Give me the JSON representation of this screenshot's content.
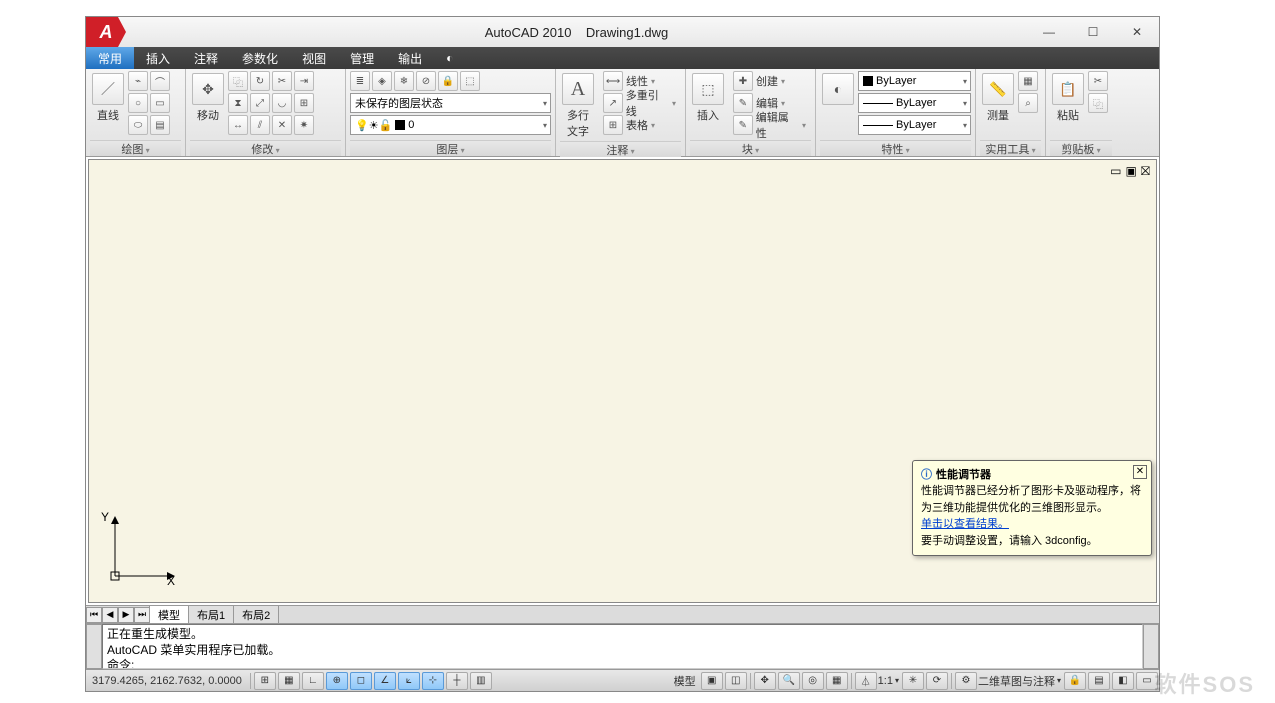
{
  "title": {
    "app": "AutoCAD 2010",
    "doc": "Drawing1.dwg"
  },
  "menu": [
    "常用",
    "插入",
    "注释",
    "参数化",
    "视图",
    "管理",
    "输出",
    "◐"
  ],
  "menu_active": 0,
  "panels": {
    "draw": {
      "title": "绘图",
      "line_label": "直线"
    },
    "modify": {
      "title": "修改",
      "move_label": "移动"
    },
    "layer": {
      "title": "图层",
      "state": "未保存的图层状态",
      "current": "0",
      "sun": "☀"
    },
    "annot": {
      "title": "注释",
      "mtext": "多行\n文字",
      "items": [
        "线性",
        "多重引线",
        "表格"
      ]
    },
    "block": {
      "title": "块",
      "insert": "插入",
      "items": [
        "创建",
        "编辑",
        "编辑属性"
      ]
    },
    "prop": {
      "title": "特性",
      "bylayer": "ByLayer",
      "match": "⬚"
    },
    "util": {
      "title": "实用工具",
      "measure": "测量"
    },
    "clip": {
      "title": "剪贴板",
      "paste": "粘贴"
    }
  },
  "axis": {
    "x": "X",
    "y": "Y"
  },
  "layout_tabs": [
    "模型",
    "布局1",
    "布局2"
  ],
  "cmd": {
    "line1": "正在重生成模型。",
    "line2": "AutoCAD 菜单实用程序已加载。",
    "prompt": "命令:"
  },
  "statusbar": {
    "coords": "3179.4265, 2162.7632, 0.0000",
    "model_label": "模型",
    "scale": "1:1",
    "workspace": "二维草图与注释"
  },
  "tooltip": {
    "title": "性能调节器",
    "body1": "性能调节器已经分析了图形卡及驱动程序，将为三维功能提供优化的三维图形显示。",
    "link": "单击以查看结果。",
    "body2": "要手动调整设置，请输入 3dconfig。"
  },
  "watermark": "软件SOS"
}
